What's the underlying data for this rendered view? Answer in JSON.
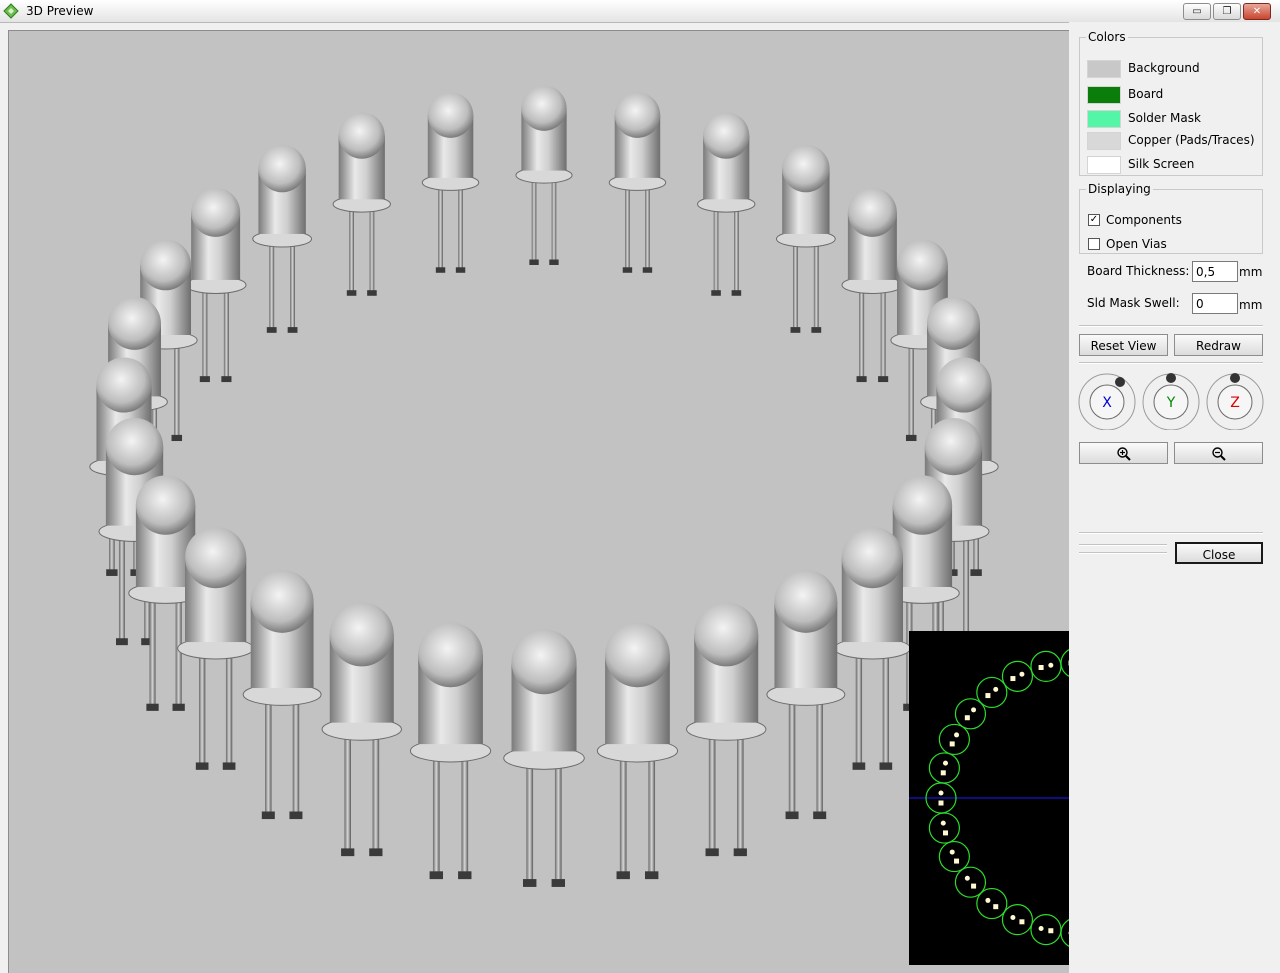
{
  "window": {
    "title": "3D Preview",
    "controls": {
      "minimize": "▭",
      "restore": "❐",
      "close": "✕"
    }
  },
  "colors": {
    "legend": "Colors",
    "items": [
      {
        "label": "Background",
        "hex": "#c8c8c8"
      },
      {
        "label": "Board",
        "hex": "#0a7d0a"
      },
      {
        "label": "Solder Mask",
        "hex": "#55f5a8"
      },
      {
        "label": "Copper (Pads/Traces)",
        "hex": "#d8d8d8"
      },
      {
        "label": "Silk Screen",
        "hex": "#ffffff"
      }
    ]
  },
  "displaying": {
    "legend": "Displaying",
    "components": {
      "label": "Components",
      "checked": true,
      "mark": "✓"
    },
    "open_vias": {
      "label": "Open Vias",
      "checked": false,
      "mark": ""
    }
  },
  "board_thickness": {
    "label": "Board Thickness:",
    "value": "0,5",
    "unit": "mm"
  },
  "sld_mask_swell": {
    "label": "Sld Mask Swell:",
    "value": "0",
    "unit": "mm"
  },
  "buttons": {
    "reset_view": "Reset View",
    "redraw": "Redraw",
    "close": "Close"
  },
  "axes": [
    {
      "label": "X",
      "color": "#0000dd"
    },
    {
      "label": "Y",
      "color": "#008800"
    },
    {
      "label": "Z",
      "color": "#dd0000"
    }
  ],
  "zoom": {
    "in_icon": "zoom-in-icon",
    "out_icon": "zoom-out-icon"
  },
  "scene": {
    "led_count": 28,
    "minimap_pad_count": 28
  }
}
